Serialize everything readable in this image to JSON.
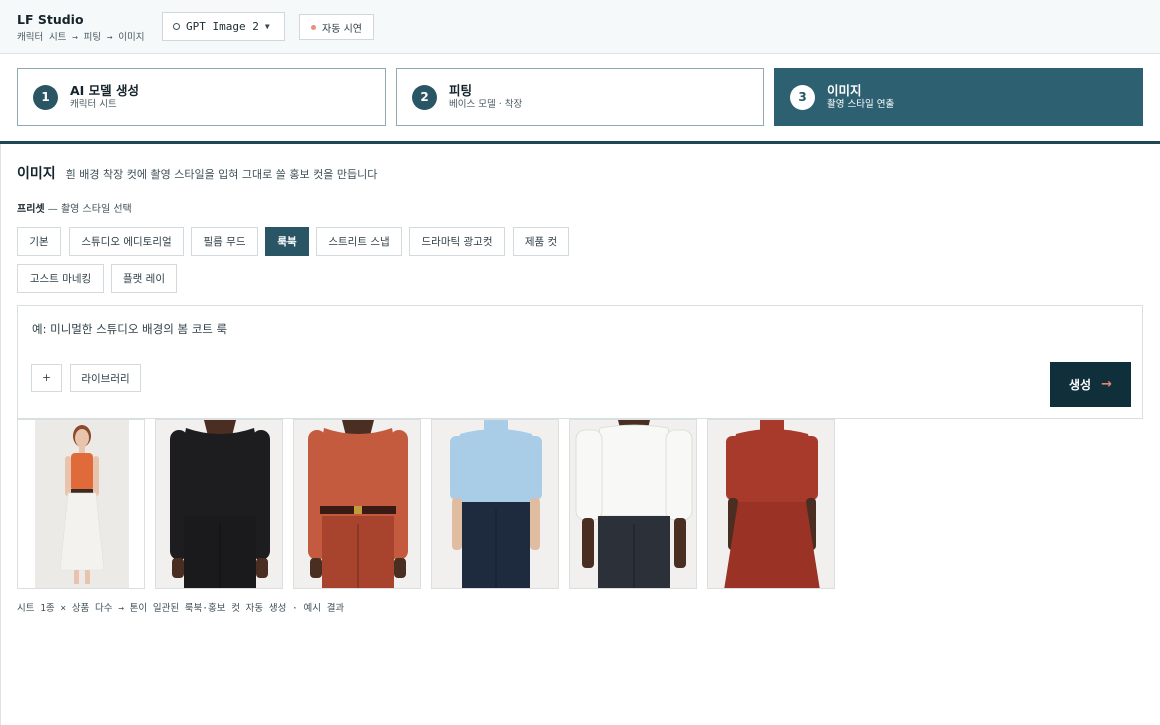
{
  "header": {
    "app_title": "LF Studio",
    "breadcrumb": "캐릭터 시트 → 피팅 → 이미지",
    "model_select": "GPT Image 2",
    "demo_button": "자동 시연"
  },
  "steps": [
    {
      "num": "1",
      "title": "AI 모델 생성",
      "sub": "캐릭터 시트",
      "active": false
    },
    {
      "num": "2",
      "title": "피팅",
      "sub": "베이스 모델 · 착장",
      "active": false
    },
    {
      "num": "3",
      "title": "이미지",
      "sub": "촬영 스타일 연출",
      "active": true
    }
  ],
  "section": {
    "title": "이미지",
    "description": "흰 배경 착장 컷에 촬영 스타일을 입혀 그대로 쓸 홍보 컷을 만듭니다"
  },
  "presets": {
    "label_bold": "프리셋",
    "label_rest": " — 촬영 스타일 선택",
    "items": [
      "기본",
      "스튜디오 에디토리얼",
      "필름 무드",
      "룩북",
      "스트리트 스냅",
      "드라마틱 광고컷",
      "제품 컷",
      "고스트 마네킹",
      "플랫 레이"
    ],
    "selected": "룩북"
  },
  "prompt": {
    "placeholder": "예: 미니멀한 스튜디오 배경의 봄 코트 룩",
    "add_label": "+",
    "library_label": "라이브러리",
    "generate_label": "생성",
    "generate_arrow": "→"
  },
  "gallery": [
    {
      "name": "model-orange-tank-white-skirt",
      "top": "#e06a3a",
      "bottom": "#f4f2ee",
      "skin": "#e8c4ad",
      "bg": "#eceae6"
    },
    {
      "name": "model-black-knit-black-pants",
      "top": "#1d1d1f",
      "bottom": "#1a1a1c",
      "skin": "#4a2e22",
      "bg": "#f1f0ee"
    },
    {
      "name": "model-rust-knit-rust-pants",
      "top": "#c45a3e",
      "bottom": "#a8432e",
      "skin": "#4a2e22",
      "bg": "#f1f0ee"
    },
    {
      "name": "model-blue-turtleneck-navy-pants",
      "top": "#a9cde6",
      "bottom": "#1e2a3e",
      "skin": "#e0bca0",
      "bg": "#f1f0ee"
    },
    {
      "name": "model-white-shirt-dark-pants",
      "top": "#f8f8f6",
      "bottom": "#2c3038",
      "skin": "#4a2e22",
      "bg": "#f1f0ee"
    },
    {
      "name": "model-red-turtleneck-red-skirt",
      "top": "#a83a2c",
      "bottom": "#9a3226",
      "skin": "#4a2e22",
      "bg": "#f1f0ee"
    }
  ],
  "caption": "시트 1종 × 상품 다수 → 톤이 일관된 룩북·홍보 컷 자동 생성 · 예시 결과"
}
